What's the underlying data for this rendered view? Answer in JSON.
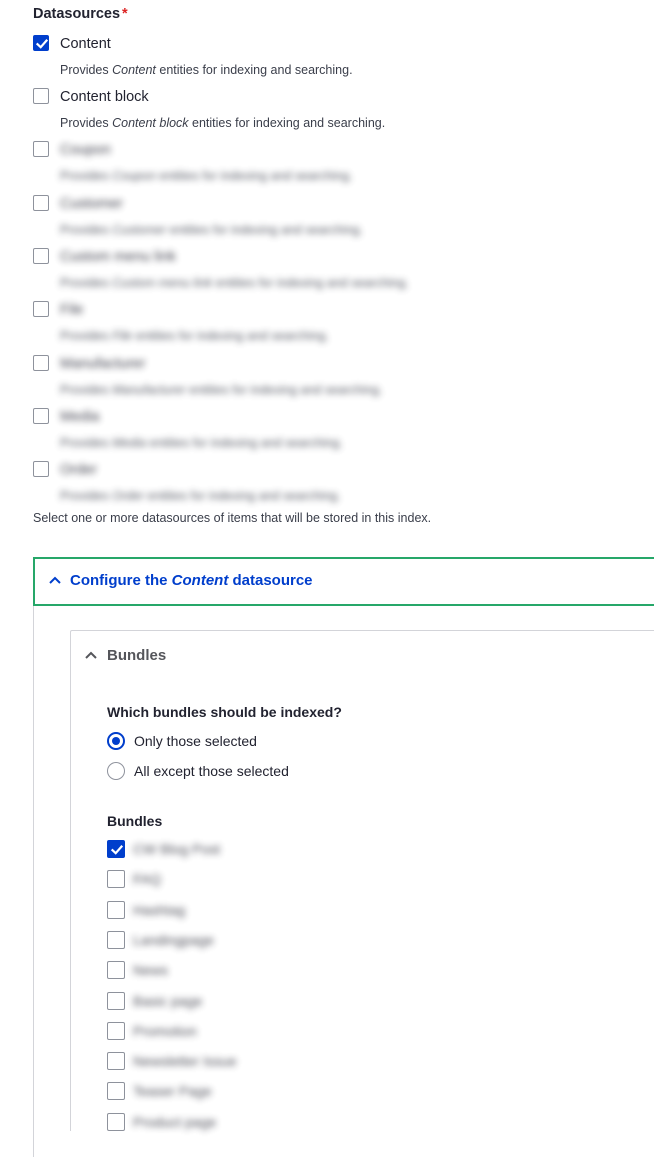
{
  "datasources": {
    "title": "Datasources",
    "required_marker": "*",
    "helper": "Select one or more datasources of items that will be stored in this index.",
    "options": [
      {
        "label": "Content",
        "checked": true,
        "desc_prefix": "Provides ",
        "desc_em": "Content",
        "desc_suffix": " entities for indexing and searching.",
        "blurred": false
      },
      {
        "label": "Content block",
        "checked": false,
        "desc_prefix": "Provides ",
        "desc_em": "Content block",
        "desc_suffix": " entities for indexing and searching.",
        "blurred": false
      },
      {
        "label": "Coupon",
        "checked": false,
        "desc_prefix": "Provides ",
        "desc_em": "Coupon",
        "desc_suffix": " entities for indexing and searching.",
        "blurred": true
      },
      {
        "label": "Customer",
        "checked": false,
        "desc_prefix": "Provides ",
        "desc_em": "Customer",
        "desc_suffix": " entities for indexing and searching.",
        "blurred": true
      },
      {
        "label": "Custom menu link",
        "checked": false,
        "desc_prefix": "Provides ",
        "desc_em": "Custom menu link",
        "desc_suffix": " entities for indexing and searching.",
        "blurred": true
      },
      {
        "label": "File",
        "checked": false,
        "desc_prefix": "Provides ",
        "desc_em": "File",
        "desc_suffix": " entities for indexing and searching.",
        "blurred": true
      },
      {
        "label": "Manufacturer",
        "checked": false,
        "desc_prefix": "Provides ",
        "desc_em": "Manufacturer",
        "desc_suffix": " entities for indexing and searching.",
        "blurred": true
      },
      {
        "label": "Media",
        "checked": false,
        "desc_prefix": "Provides ",
        "desc_em": "Media",
        "desc_suffix": " entities for indexing and searching.",
        "blurred": true
      },
      {
        "label": "Order",
        "checked": false,
        "desc_prefix": "Provides ",
        "desc_em": "Order",
        "desc_suffix": " entities for indexing and searching.",
        "blurred": true
      }
    ]
  },
  "configure": {
    "title_prefix": "Configure the ",
    "title_em": "Content",
    "title_suffix": " datasource",
    "expanded": true
  },
  "bundles_panel": {
    "title": "Bundles",
    "question": "Which bundles should be indexed?",
    "radios": [
      {
        "label": "Only those selected",
        "selected": true
      },
      {
        "label": "All except those selected",
        "selected": false
      }
    ],
    "list_title": "Bundles",
    "items": [
      {
        "label": "CW Blog Post",
        "checked": true
      },
      {
        "label": "FAQ",
        "checked": false
      },
      {
        "label": "Hashtag",
        "checked": false
      },
      {
        "label": "Landingpage",
        "checked": false
      },
      {
        "label": "News",
        "checked": false
      },
      {
        "label": "Basic page",
        "checked": false
      },
      {
        "label": "Promotion",
        "checked": false
      },
      {
        "label": "Newsletter Issue",
        "checked": false
      },
      {
        "label": "Teaser Page",
        "checked": false
      },
      {
        "label": "Product page",
        "checked": false
      }
    ]
  },
  "colors": {
    "accent": "#003ecc",
    "focus_border": "#26a769",
    "required": "#dc2323"
  }
}
